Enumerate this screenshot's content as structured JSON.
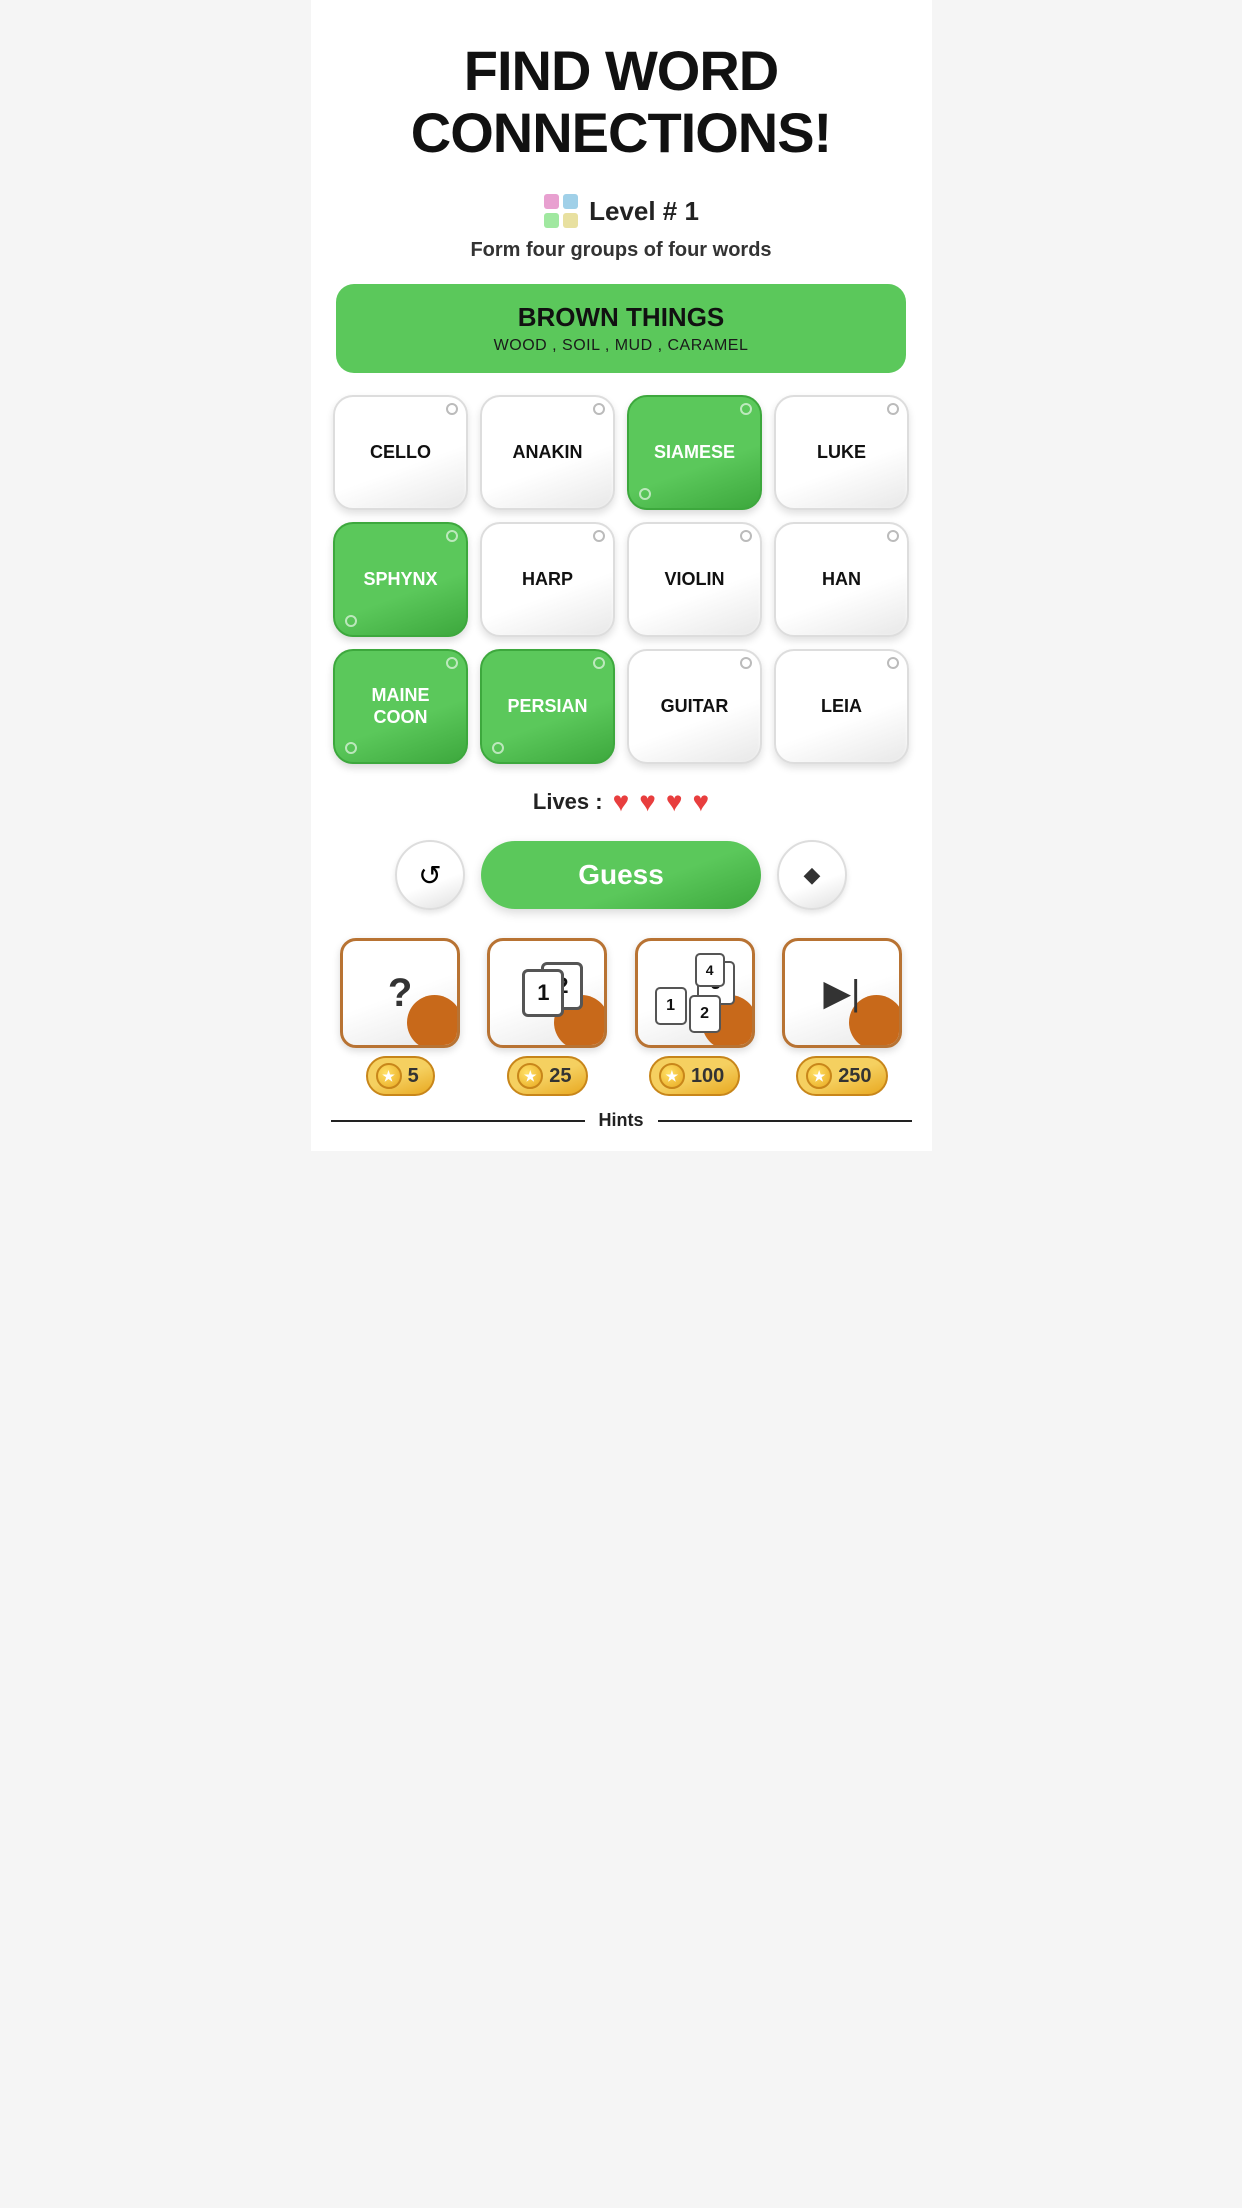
{
  "header": {
    "title_line1": "FIND WORD",
    "title_line2": "CONNECTIONS!"
  },
  "level": {
    "icon_label": "grid-icon",
    "text": "Level # 1"
  },
  "subtitle": "Form four groups of four words",
  "solved_group": {
    "title": "BROWN THINGS",
    "words": "WOOD , SOIL , MUD , CARAMEL"
  },
  "tiles": [
    {
      "word": "CELLO",
      "selected": false
    },
    {
      "word": "ANAKIN",
      "selected": false
    },
    {
      "word": "SIAMESE",
      "selected": true
    },
    {
      "word": "LUKE",
      "selected": false
    },
    {
      "word": "SPHYNX",
      "selected": true
    },
    {
      "word": "HARP",
      "selected": false
    },
    {
      "word": "VIOLIN",
      "selected": false
    },
    {
      "word": "HAN",
      "selected": false
    },
    {
      "word": "MAINE\nCOON",
      "selected": true
    },
    {
      "word": "PERSIAN",
      "selected": true
    },
    {
      "word": "GUITAR",
      "selected": false
    },
    {
      "word": "LEIA",
      "selected": false
    }
  ],
  "lives": {
    "label": "Lives :",
    "count": 4,
    "heart": "♥"
  },
  "controls": {
    "shuffle_icon": "↺",
    "guess_label": "Guess",
    "erase_icon": "◆"
  },
  "hints": [
    {
      "type": "question",
      "cost": "5"
    },
    {
      "type": "number12",
      "cost": "25"
    },
    {
      "type": "number123",
      "cost": "100"
    },
    {
      "type": "play",
      "cost": "250"
    }
  ],
  "hints_label": "Hints"
}
